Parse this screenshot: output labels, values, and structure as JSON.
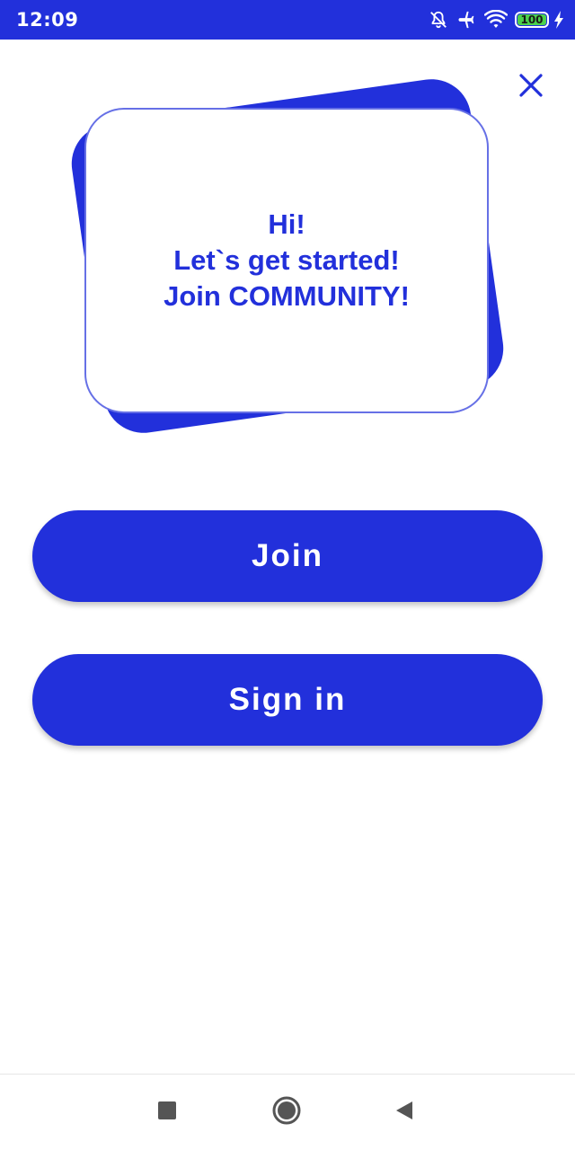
{
  "status_bar": {
    "time": "12:09",
    "battery_level": "100",
    "icons": [
      "silent-icon",
      "airplane-icon",
      "wifi-icon",
      "battery-icon",
      "charging-icon"
    ]
  },
  "colors": {
    "primary": "#2230db",
    "card_border": "#6670e6",
    "battery_fill": "#4cd14c",
    "background": "#ffffff"
  },
  "card": {
    "line1": "Hi!",
    "line2": "Let`s get started!",
    "line3": "Join COMMUNITY!"
  },
  "buttons": {
    "join_label": "Join",
    "signin_label": "Sign in"
  },
  "close": {
    "icon": "close-icon"
  },
  "nav": {
    "icons": [
      "recents-icon",
      "home-icon",
      "back-icon"
    ]
  }
}
